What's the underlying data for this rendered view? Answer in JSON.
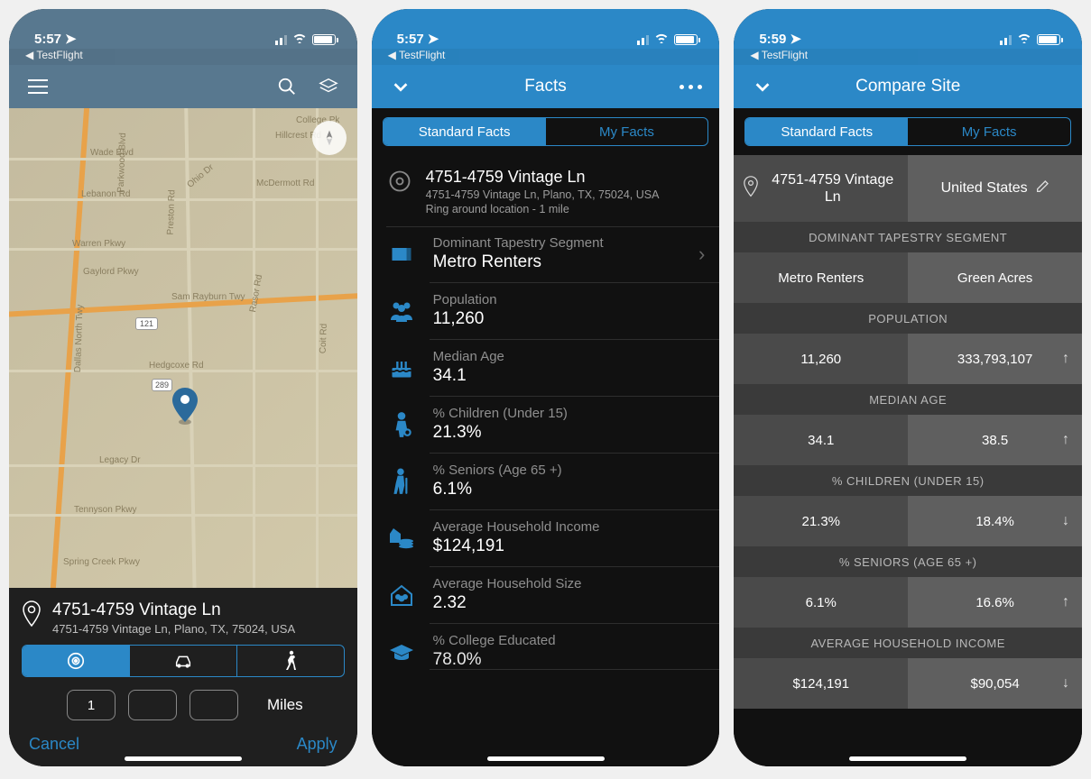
{
  "status": {
    "time1": "5:57",
    "time2": "5:57",
    "time3": "5:59",
    "backapp": "TestFlight"
  },
  "screen1": {
    "address_title": "4751-4759 Vintage Ln",
    "address_sub": "4751-4759 Vintage Ln, Plano, TX, 75024, USA",
    "ring_values": [
      "1",
      "",
      ""
    ],
    "unit": "Miles",
    "cancel": "Cancel",
    "apply": "Apply",
    "roads": [
      "Lebanon Rd",
      "Ohio Dr",
      "Warren Pkwy",
      "Gaylord Pkwy",
      "Sam Rayburn Twy",
      "Legacy Dr",
      "Tennyson Pkwy",
      "Spring Creek Pkwy",
      "Dallas North Twy",
      "Preston Rd",
      "Hedgcoxe Rd",
      "Rasor Rd",
      "McDermott Rd",
      "Coit Rd",
      "Parkwood Blvd",
      "Wade Blvd",
      "Hillcrest Rd",
      "College Pk",
      "121",
      "289"
    ]
  },
  "screen2": {
    "title": "Facts",
    "tabs": [
      "Standard Facts",
      "My Facts"
    ],
    "loc_title": "4751-4759 Vintage Ln",
    "loc_sub": "4751-4759 Vintage Ln, Plano, TX, 75024, USA",
    "loc_ring": "Ring around location - 1 mile",
    "facts": [
      {
        "label": "Dominant Tapestry Segment",
        "value": "Metro Renters",
        "chevron": true
      },
      {
        "label": "Population",
        "value": "11,260"
      },
      {
        "label": "Median Age",
        "value": "34.1"
      },
      {
        "label": "% Children (Under 15)",
        "value": "21.3%"
      },
      {
        "label": "% Seniors (Age 65 +)",
        "value": "6.1%"
      },
      {
        "label": "Average Household Income",
        "value": "$124,191"
      },
      {
        "label": "Average Household Size",
        "value": "2.32"
      },
      {
        "label": "% College Educated",
        "value": "78.0%"
      }
    ]
  },
  "screen3": {
    "title": "Compare Site",
    "tabs": [
      "Standard Facts",
      "My Facts"
    ],
    "colA_title": "4751-4759 Vintage Ln",
    "colB_title": "United States",
    "sections": [
      {
        "name": "DOMINANT TAPESTRY SEGMENT",
        "a": "Metro Renters",
        "b": "Green Acres",
        "dir": ""
      },
      {
        "name": "POPULATION",
        "a": "11,260",
        "b": "333,793,107",
        "dir": "up"
      },
      {
        "name": "MEDIAN AGE",
        "a": "34.1",
        "b": "38.5",
        "dir": "up"
      },
      {
        "name": "% CHILDREN (UNDER 15)",
        "a": "21.3%",
        "b": "18.4%",
        "dir": "down"
      },
      {
        "name": "% SENIORS (AGE 65 +)",
        "a": "6.1%",
        "b": "16.6%",
        "dir": "up"
      },
      {
        "name": "AVERAGE HOUSEHOLD INCOME",
        "a": "$124,191",
        "b": "$90,054",
        "dir": "down"
      }
    ]
  }
}
